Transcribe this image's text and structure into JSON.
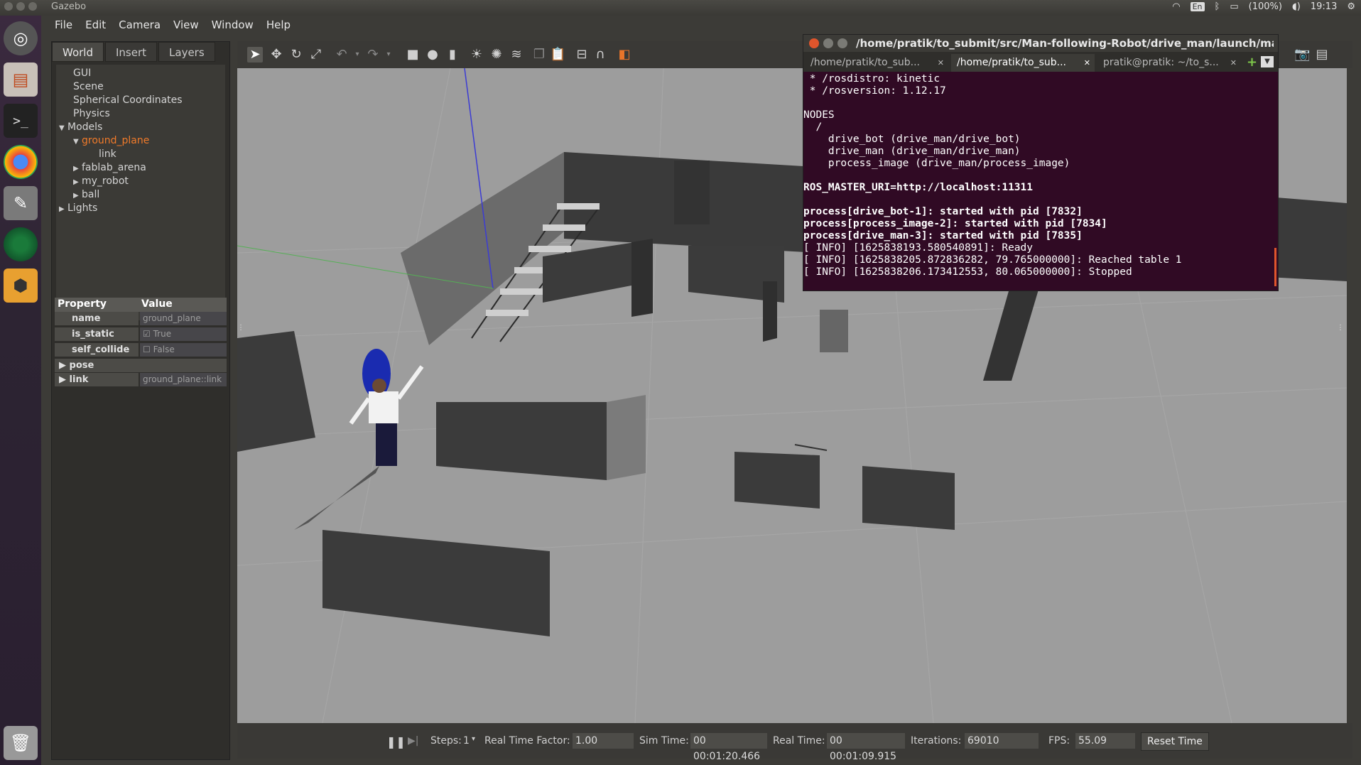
{
  "system": {
    "app_title": "Gazebo",
    "lang": "En",
    "battery": "(100%)",
    "time": "19:13"
  },
  "menu": [
    "File",
    "Edit",
    "Camera",
    "View",
    "Window",
    "Help"
  ],
  "left_panel": {
    "tabs": [
      "World",
      "Insert",
      "Layers"
    ],
    "tree": {
      "gui": "GUI",
      "scene": "Scene",
      "spherical": "Spherical Coordinates",
      "physics": "Physics",
      "models": "Models",
      "ground_plane": "ground_plane",
      "link": "link",
      "fablab_arena": "fablab_arena",
      "my_robot": "my_robot",
      "ball": "ball",
      "lights": "Lights"
    },
    "properties": {
      "col_property": "Property",
      "col_value": "Value",
      "name_key": "name",
      "name_val": "ground_plane",
      "is_static_key": "is_static",
      "is_static_val": "True",
      "self_collide_key": "self_collide",
      "self_collide_val": "False",
      "pose_key": "pose",
      "link_key": "link",
      "link_val": "ground_plane::link"
    }
  },
  "terminal": {
    "title": "/home/pratik/to_submit/src/Man-following-Robot/drive_man/launch/man_chase",
    "tabs": [
      "/home/pratik/to_sub...",
      "/home/pratik/to_sub...",
      "pratik@pratik: ~/to_s..."
    ],
    "lines": [
      " * /rosdistro: kinetic",
      " * /rosversion: 1.12.17",
      "",
      "NODES",
      "  /",
      "    drive_bot (drive_man/drive_bot)",
      "    drive_man (drive_man/drive_man)",
      "    process_image (drive_man/process_image)",
      "",
      "ROS_MASTER_URI=http://localhost:11311",
      "",
      "process[drive_bot-1]: started with pid [7832]",
      "process[process_image-2]: started with pid [7834]",
      "process[drive_man-3]: started with pid [7835]",
      "[ INFO] [1625838193.580540891]: Ready",
      "[ INFO] [1625838205.872836282, 79.765000000]: Reached table 1",
      "[ INFO] [1625838206.173412553, 80.065000000]: Stopped"
    ]
  },
  "bottom_bar": {
    "steps_label": "Steps:",
    "steps_val": "1",
    "rtf_label": "Real Time Factor:",
    "rtf_val": "1.00",
    "sim_label": "Sim Time:",
    "sim_val": "00 00:01:20.466",
    "real_label": "Real Time:",
    "real_val": "00 00:01:09.915",
    "iter_label": "Iterations:",
    "iter_val": "69010",
    "fps_label": "FPS:",
    "fps_val": "55.09",
    "reset_label": "Reset Time"
  }
}
